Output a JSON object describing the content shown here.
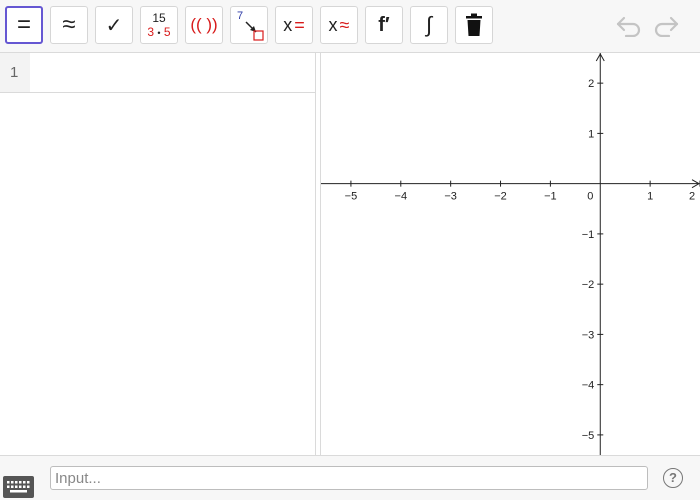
{
  "toolbar": {
    "evaluate_label": "=",
    "numeric_label": "≈",
    "keep_input_label": "✓",
    "factor_top": "15",
    "factor_bottom_left": "3",
    "factor_dot": "•",
    "factor_bottom_right": "5",
    "expand_label": "(( ))",
    "substitute_number": "7",
    "solve_x": "x",
    "solve_eq": "=",
    "nsolve_x": "x",
    "nsolve_eq": "≈",
    "derivative_label": "f′",
    "integral_label": "∫"
  },
  "cas": {
    "rows": [
      {
        "number": "1",
        "value": ""
      }
    ]
  },
  "graphics": {
    "x_range": [
      -5.6,
      2.0
    ],
    "y_range": [
      -5.4,
      2.6
    ],
    "x_ticks": [
      "−5",
      "−4",
      "−3",
      "−2",
      "−1",
      "0",
      "1",
      "2"
    ],
    "y_ticks": [
      "2",
      "1",
      "−1",
      "−2",
      "−3",
      "−4",
      "−5"
    ]
  },
  "input_bar": {
    "placeholder": "Input..."
  },
  "help": {
    "label": "?"
  },
  "colors": {
    "active_border": "#6557d2",
    "accent_red": "#d81b1b",
    "substitute_blue": "#2c3aa5"
  }
}
